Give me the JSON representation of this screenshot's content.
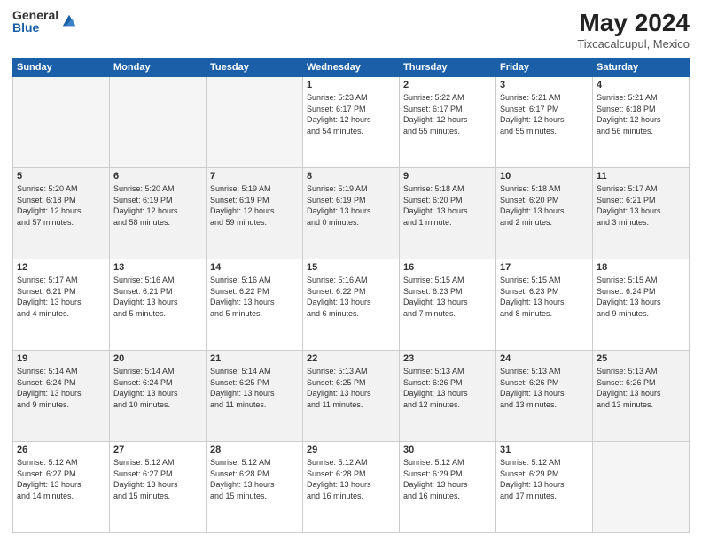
{
  "header": {
    "logo_general": "General",
    "logo_blue": "Blue",
    "month_title": "May 2024",
    "location": "Tixcacalcupul, Mexico"
  },
  "days_of_week": [
    "Sunday",
    "Monday",
    "Tuesday",
    "Wednesday",
    "Thursday",
    "Friday",
    "Saturday"
  ],
  "weeks": [
    [
      {
        "num": "",
        "info": ""
      },
      {
        "num": "",
        "info": ""
      },
      {
        "num": "",
        "info": ""
      },
      {
        "num": "1",
        "info": "Sunrise: 5:23 AM\nSunset: 6:17 PM\nDaylight: 12 hours\nand 54 minutes."
      },
      {
        "num": "2",
        "info": "Sunrise: 5:22 AM\nSunset: 6:17 PM\nDaylight: 12 hours\nand 55 minutes."
      },
      {
        "num": "3",
        "info": "Sunrise: 5:21 AM\nSunset: 6:17 PM\nDaylight: 12 hours\nand 55 minutes."
      },
      {
        "num": "4",
        "info": "Sunrise: 5:21 AM\nSunset: 6:18 PM\nDaylight: 12 hours\nand 56 minutes."
      }
    ],
    [
      {
        "num": "5",
        "info": "Sunrise: 5:20 AM\nSunset: 6:18 PM\nDaylight: 12 hours\nand 57 minutes."
      },
      {
        "num": "6",
        "info": "Sunrise: 5:20 AM\nSunset: 6:19 PM\nDaylight: 12 hours\nand 58 minutes."
      },
      {
        "num": "7",
        "info": "Sunrise: 5:19 AM\nSunset: 6:19 PM\nDaylight: 12 hours\nand 59 minutes."
      },
      {
        "num": "8",
        "info": "Sunrise: 5:19 AM\nSunset: 6:19 PM\nDaylight: 13 hours\nand 0 minutes."
      },
      {
        "num": "9",
        "info": "Sunrise: 5:18 AM\nSunset: 6:20 PM\nDaylight: 13 hours\nand 1 minute."
      },
      {
        "num": "10",
        "info": "Sunrise: 5:18 AM\nSunset: 6:20 PM\nDaylight: 13 hours\nand 2 minutes."
      },
      {
        "num": "11",
        "info": "Sunrise: 5:17 AM\nSunset: 6:21 PM\nDaylight: 13 hours\nand 3 minutes."
      }
    ],
    [
      {
        "num": "12",
        "info": "Sunrise: 5:17 AM\nSunset: 6:21 PM\nDaylight: 13 hours\nand 4 minutes."
      },
      {
        "num": "13",
        "info": "Sunrise: 5:16 AM\nSunset: 6:21 PM\nDaylight: 13 hours\nand 5 minutes."
      },
      {
        "num": "14",
        "info": "Sunrise: 5:16 AM\nSunset: 6:22 PM\nDaylight: 13 hours\nand 5 minutes."
      },
      {
        "num": "15",
        "info": "Sunrise: 5:16 AM\nSunset: 6:22 PM\nDaylight: 13 hours\nand 6 minutes."
      },
      {
        "num": "16",
        "info": "Sunrise: 5:15 AM\nSunset: 6:23 PM\nDaylight: 13 hours\nand 7 minutes."
      },
      {
        "num": "17",
        "info": "Sunrise: 5:15 AM\nSunset: 6:23 PM\nDaylight: 13 hours\nand 8 minutes."
      },
      {
        "num": "18",
        "info": "Sunrise: 5:15 AM\nSunset: 6:24 PM\nDaylight: 13 hours\nand 9 minutes."
      }
    ],
    [
      {
        "num": "19",
        "info": "Sunrise: 5:14 AM\nSunset: 6:24 PM\nDaylight: 13 hours\nand 9 minutes."
      },
      {
        "num": "20",
        "info": "Sunrise: 5:14 AM\nSunset: 6:24 PM\nDaylight: 13 hours\nand 10 minutes."
      },
      {
        "num": "21",
        "info": "Sunrise: 5:14 AM\nSunset: 6:25 PM\nDaylight: 13 hours\nand 11 minutes."
      },
      {
        "num": "22",
        "info": "Sunrise: 5:13 AM\nSunset: 6:25 PM\nDaylight: 13 hours\nand 11 minutes."
      },
      {
        "num": "23",
        "info": "Sunrise: 5:13 AM\nSunset: 6:26 PM\nDaylight: 13 hours\nand 12 minutes."
      },
      {
        "num": "24",
        "info": "Sunrise: 5:13 AM\nSunset: 6:26 PM\nDaylight: 13 hours\nand 13 minutes."
      },
      {
        "num": "25",
        "info": "Sunrise: 5:13 AM\nSunset: 6:26 PM\nDaylight: 13 hours\nand 13 minutes."
      }
    ],
    [
      {
        "num": "26",
        "info": "Sunrise: 5:12 AM\nSunset: 6:27 PM\nDaylight: 13 hours\nand 14 minutes."
      },
      {
        "num": "27",
        "info": "Sunrise: 5:12 AM\nSunset: 6:27 PM\nDaylight: 13 hours\nand 15 minutes."
      },
      {
        "num": "28",
        "info": "Sunrise: 5:12 AM\nSunset: 6:28 PM\nDaylight: 13 hours\nand 15 minutes."
      },
      {
        "num": "29",
        "info": "Sunrise: 5:12 AM\nSunset: 6:28 PM\nDaylight: 13 hours\nand 16 minutes."
      },
      {
        "num": "30",
        "info": "Sunrise: 5:12 AM\nSunset: 6:29 PM\nDaylight: 13 hours\nand 16 minutes."
      },
      {
        "num": "31",
        "info": "Sunrise: 5:12 AM\nSunset: 6:29 PM\nDaylight: 13 hours\nand 17 minutes."
      },
      {
        "num": "",
        "info": ""
      }
    ]
  ]
}
